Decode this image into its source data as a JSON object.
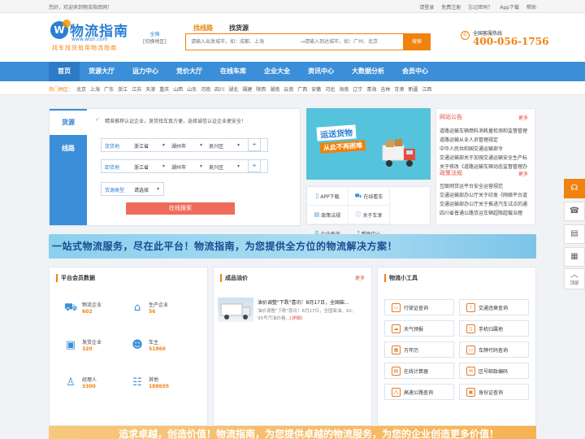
{
  "topbar": {
    "welcome": "您好，欢迎来到物流指南网！",
    "links": [
      "请登录",
      "免费注册",
      "忘记密码？",
      "App下载",
      "帮助"
    ]
  },
  "header": {
    "logo_mark": "W",
    "logo_title": "物流指南",
    "logo_url": "www.wlzn.com",
    "slogan": "找车找货就用物流指南",
    "city_name": "全国",
    "city_switch": "[切换地区]",
    "search_tabs": [
      "找线路",
      "找货源"
    ],
    "from_placeholder": "请输入出发城市，如：成都、上海",
    "to_placeholder": "请输入到达城市，如：广州、北京",
    "search_button": "搜索",
    "hotline_label": "全国客服热线",
    "hotline_number": "400-056-1756"
  },
  "nav": [
    "首页",
    "货源大厅",
    "运力中心",
    "竞价大厅",
    "在线车库",
    "企业大全",
    "资讯中心",
    "大数据分析",
    "会员中心"
  ],
  "hot": {
    "label": "热门地区：",
    "cities": [
      "北京",
      "上海",
      "广东",
      "浙江",
      "江苏",
      "天津",
      "重庆",
      "山西",
      "山东",
      "河南",
      "四川",
      "湖北",
      "福建",
      "陕西",
      "湖南",
      "云南",
      "广西",
      "安徽",
      "河北",
      "海南",
      "辽宁",
      "青海",
      "吉林",
      "甘肃",
      "新疆",
      "江西"
    ]
  },
  "search_panel": {
    "tabs": [
      "货源",
      "线路"
    ],
    "notice": "精准推荐认证企业，发货找车真方便，选择诚信认证企业更安全！",
    "origin_label": "货货地",
    "dest_label": "卸货地",
    "type_label": "货源类型",
    "province": "浙江省",
    "city": "湖州市",
    "district": "吴兴区",
    "type_value": "请选择",
    "submit": "在线搜索"
  },
  "promo": {
    "line1": "运送货物",
    "line2": "从此不再困难"
  },
  "services": [
    "APP下载",
    "在线看车",
    "政策法规",
    "关于车享",
    "企业查询",
    "帮助中心"
  ],
  "news": {
    "section1_title": "网站公告",
    "section1_more": "更多",
    "section1_items": [
      "道路运输车辆燃料消耗量检测和监督管理",
      "道路运输从业人员管理规定",
      "中华人民共和国交通运输部令",
      "交通运输部关于加强交通运输安全生产标",
      "关于修改《道路运输车辆动态监督管理办"
    ],
    "section2_title": "政策法规",
    "section2_more": "更多",
    "section2_items": [
      "互联网货运平台安全运营规范",
      "交通运输部办公厅关于印发《网络平台道",
      "交通运输部办公厅关于推进汽车试点的通",
      "四川省普通公路货运车辆超限超载治理"
    ]
  },
  "slogan": "一站式物流服务，尽在此平台！物流指南，为您提供全方位的物流解决方案！",
  "members": {
    "title": "平台会员数据",
    "items": [
      {
        "name": "物流企业",
        "count": "602"
      },
      {
        "name": "生产企业",
        "count": "56"
      },
      {
        "name": "发货企业",
        "count": "320"
      },
      {
        "name": "车主",
        "count": "51860"
      },
      {
        "name": "经理人",
        "count": "3300"
      },
      {
        "name": "其他",
        "count": "188695"
      }
    ]
  },
  "oil": {
    "title": "成品油价",
    "more": "更多",
    "headline": "油价调整\"下跌\"喜讯！8月17日，全国柴...",
    "desc": "油价调整\"下跌\"喜讯！8月17日，全国柴油、92、95号汽油价格...",
    "detail": "[详细]"
  },
  "tools": {
    "title": "物流小工具",
    "items": [
      "行驶证查询",
      "交通违章查询",
      "天气预报",
      "手机归属地",
      "万年历",
      "车牌代码查询",
      "在线计算器",
      "区号邮政编码",
      "高速公路查询",
      "身份证查询"
    ]
  },
  "float_bar": {
    "top_label": "顶部"
  },
  "bottom_banner": "追求卓越，创造价值！物流指南，为您提供卓越的物流服务，为您的企业创造更多价值！"
}
